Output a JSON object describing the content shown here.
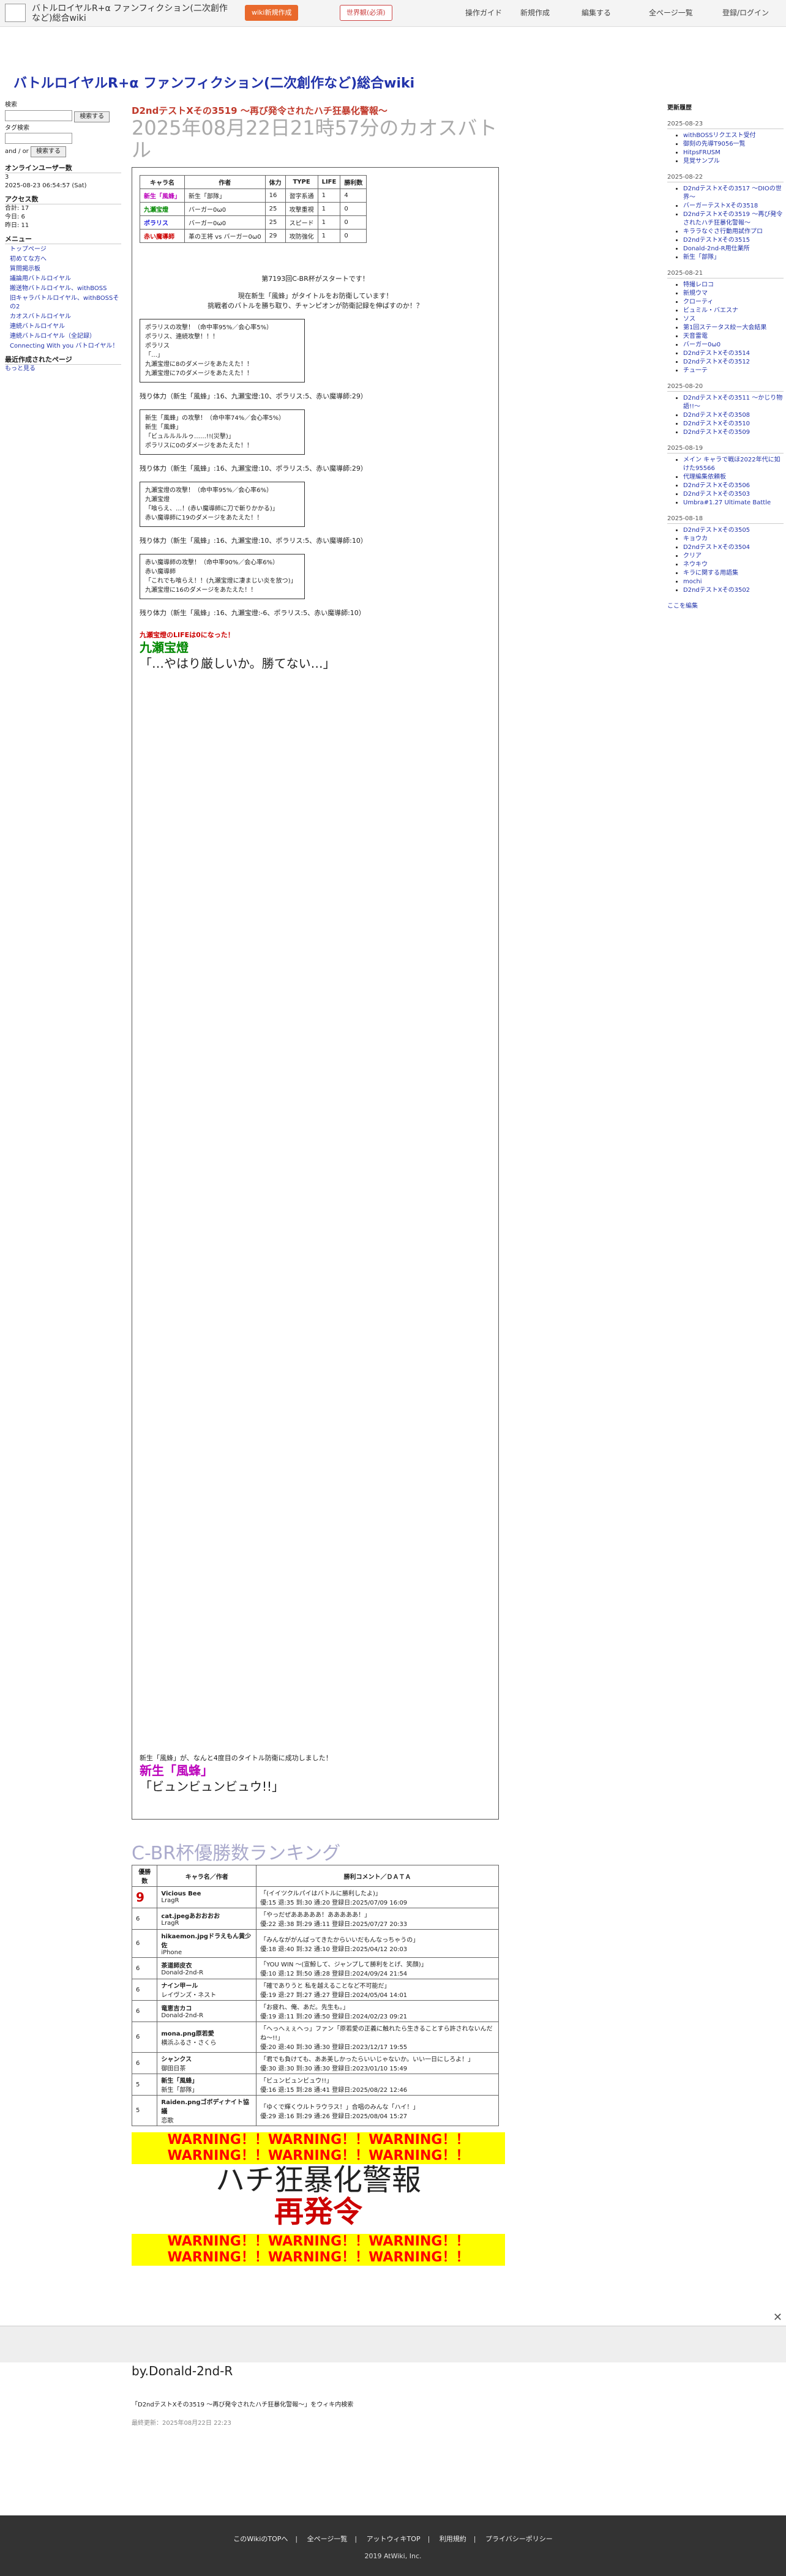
{
  "site": {
    "name": "バトルロイヤルR+α ファンフィクション(二次創作など)総合wiki",
    "title": "バトルロイヤルR+α ファンフィクション(二次創作など)総合wiki",
    "buttons": {
      "wiki_new": "wiki新規作成",
      "blank_request": "世界観(必須)",
      "guide": "操作ガイド",
      "new_page": "新規作成",
      "edit": "編集する",
      "all_pages": "全ページ一覧",
      "login": "登録/ログイン"
    }
  },
  "sidebar": {
    "search_label": "検索",
    "search_btn": "検索する",
    "tag_label": "タグ検索",
    "and_label": "and",
    "or_label": "or",
    "tag_btn": "検索する",
    "online_heading": "オンラインユーザー数",
    "online_count": "3",
    "online_date": "2025-08-23 06:54:57 (Sat)",
    "access_heading": "アクセス数",
    "access_total": "合計: 17",
    "access_today": "今日: 6",
    "access_yesterday": "昨日: 11",
    "menu_heading": "メニュー",
    "menu_items": [
      "トップページ",
      "初めてな方へ",
      "質問掲示板",
      "議論用バトルロイヤル",
      "搬送物バトルロイヤル、withBOSS",
      "旧キャラバトルロイヤル、withBOSSその2",
      "カオスバトルロイヤル",
      "連続バトルロイヤル",
      "連続バトルロイヤル（全記録）",
      "Connecting With you バトロイヤル！"
    ],
    "recent_heading": "最近作成されたページ",
    "more": "もっと見る"
  },
  "main": {
    "page_title": "D2ndテストXその3519 〜再び発令されたハチ狂暴化警報〜",
    "subtitle": "2025年08月22日21時57分のカオスバトル",
    "roster_headers": [
      "キャラ名",
      "作者",
      "体力",
      "TYPE",
      "LIFE",
      "勝利数"
    ],
    "roster": [
      {
        "name": "新生「風蜂」",
        "author": "新生「部隊」",
        "hp": "16",
        "type": "習字系通",
        "life": "1",
        "wins": "4"
      },
      {
        "name": "九瀬宝燈",
        "author": "バーガー0ω0",
        "hp": "25",
        "type": "攻撃重視",
        "life": "1",
        "wins": "0"
      },
      {
        "name": "ポラリス",
        "author": "バーガー0ω0",
        "hp": "25",
        "type": "スピード",
        "life": "1",
        "wins": "0"
      },
      {
        "name": "赤い魔導師",
        "author": "革の王将 vs バーガー0ω0",
        "hp": "29",
        "type": "攻防強化",
        "life": "1",
        "wins": "0"
      }
    ],
    "start_line": "第7193回C-BR杯がスタートです！",
    "intro_line1": "現在新生「風蜂」がタイトルをお防衛しています！",
    "intro_line2": "挑戦者のバトルを勝ち取り、チャンピオンが防衛記録を伸ばすのか！？",
    "turns": [
      {
        "text": "ポラリスの攻撃！（命中率95%／会心率5%）\nポラリス、連続攻撃！！！\nポラリス\n「…」\n九瀬宝燈に8のダメージをあたえた！！\n九瀬宝燈に7のダメージをあたえた！！",
        "remain": "残り体力（新生「風蜂」:16、九瀬宝燈:10、ポラリス:5、赤い魔導師:29）"
      },
      {
        "text": "新生「風蜂」の攻撃！（命中率74%／会心率5%）\n新生「風蜂」\n「ビュルルルルゥ……!!(災撃)」\nポラリスに0のダメージをあたえた！！",
        "remain": "残り体力（新生「風蜂」:16、九瀬宝燈:10、ポラリス:5、赤い魔導師:29）"
      },
      {
        "text": "九瀬宝燈の攻撃！（命中率95%／会心率6%）\n九瀬宝燈\n「喰らえ、…！(赤い魔導師に刀で斬りかかる)」\n赤い魔導師に19のダメージをあたえた！！",
        "remain": "残り体力（新生「風蜂」:16、九瀬宝燈:10、ポラリス:5、赤い魔導師:10）"
      },
      {
        "text": "赤い魔導師の攻撃！（命中率90%／会心率6%）\n赤い魔導師\n「これでも喰らえ！！(九瀬宝燈に凄まじい炎を放つ)」\n九瀬宝燈に16のダメージをあたえた！！",
        "remain": "残り体力（新生「風蜂」:16、九瀬宝燈:-6、ポラリス:5、赤い魔導師:10）"
      }
    ],
    "defeat1": "九瀬宝燈のLIFEは0になった！",
    "defeat1_big": "九瀬宝燈",
    "defeat1_quote": "「…やはり厳しいか。勝てない…」",
    "end_line": "新生「風蜂」が、なんと4度目のタイトル防衛に成功しました！",
    "winner_big": "新生「風蜂」",
    "winner_quote": "「ビュンビュンビュウ!!」"
  },
  "ranking": {
    "title": "C-BR杯優勝数ランキング",
    "headers": [
      "優勝数",
      "キャラ名／作者",
      "勝利コメント／ＤＡＴＡ"
    ],
    "rows": [
      {
        "wins": "9",
        "name": "Vicious Bee",
        "author": "LragR",
        "comment": "「(イイツクルパイはバトルに勝利したよ)」",
        "data": "優:15 退:35 到:30 通:20 登録日:2025/07/09 16:09"
      },
      {
        "wins": "6",
        "name": "cat.jpegあおおおお",
        "author": "LragR",
        "comment": "「やっだぜあああああ！あああああ！」",
        "data": "優:22 退:38 到:29 通:11 登録日:2025/07/27 20:33"
      },
      {
        "wins": "6",
        "name": "hikaemon.jpgドラえもん黄少佐",
        "author": "iPhone",
        "comment": "「みんなががんばってきたからいいだもんなっちゃうの」",
        "data": "優:18 退:40 到:32 通:10 登録日:2025/04/12 20:03"
      },
      {
        "wins": "6",
        "name": "茶道師皮衣",
        "author": "Donald-2nd-R",
        "comment": "「YOU WIN 〜(宣鯨して、ジャンプして勝利をとげ、笑顔)」",
        "data": "優:10 退:12 到:50 通:28 登録日:2024/09/24 21:54"
      },
      {
        "wins": "6",
        "name": "ナイン甲ール",
        "author": "レイヴンズ・ネスト",
        "comment": "「確でありうと 私を越えることなど不可能だ」",
        "data": "優:19 退:27 到:27 通:27 登録日:2024/05/04 14:01"
      },
      {
        "wins": "6",
        "name": "竜恵吉カコ",
        "author": "Donald-2nd-R",
        "comment": "「お疲れ、俺、あだ。先生も。」",
        "data": "優:19 退:11 到:20 通:50 登録日:2024/02/23 09:21"
      },
      {
        "wins": "6",
        "name": "mona.png原若愛",
        "author": "横浜ふるさ・さくら",
        "comment": "「へっへぇぇへっ」ファン「原若愛の正義に触れたら生きることすら許されないんだね〜!!」",
        "data": "優:20 退:40 到:30 通:30 登録日:2023/12/17 19:55"
      },
      {
        "wins": "6",
        "name": "シャンクス",
        "author": "御田日茶",
        "comment": "「君でも負けても、ああ美しかったらいいじゃないか。いい一日にしろよ！」",
        "data": "優:30 退:30 到:30 通:30 登録日:2023/01/10 15:49"
      },
      {
        "wins": "5",
        "name": "新生「風蜂」",
        "author": "新生「部隊」",
        "comment": "「ビュンビュンビュウ!!」",
        "data": "優:16 退:15 到:28 通:41 登録日:2025/08/22 12:46"
      },
      {
        "wins": "5",
        "name": "Raiden.pngゴボディナイト協議",
        "author": "恋歌",
        "comment": "「ゆくで輝くウルトラウラス！」合唱のみんな「ハイ！」",
        "data": "優:29 退:16 到:29 通:26 登録日:2025/08/04 15:27"
      }
    ]
  },
  "warning": {
    "banner": "WARNING！！WARNING！！WARNING！！WARNING！！WARNING！！WARNING！！",
    "line1": "ハチ狂暴化警報",
    "line2": "再発令"
  },
  "byline": "by.Donald-2nd-R",
  "tagline": "「D2ndテストXその3519 〜再び発令されたハチ狂暴化警報〜」をウィキ内検索",
  "updated": "最終更新：2025年08月22日 22:23",
  "right": {
    "heading": "更新履歴",
    "groups": [
      {
        "date": "2025-08-23",
        "items": [
          "withBOSSリクエスト受付",
          "御刻の先導T9056一覧",
          "HitpsFRUSM",
          "見覚サンプル"
        ]
      },
      {
        "date": "2025-08-22",
        "items": [
          "D2ndテストXその3517 〜DIOの世界〜",
          "バーガーテストXその3518",
          "D2ndテストXその3519 〜再び発令されたハチ狂暴化警報〜",
          "キララなぐさ行動用試作プロ",
          "D2ndテストXその3515",
          "Donald-2nd-R用仕業所",
          "新生「部隊」"
        ]
      },
      {
        "date": "2025-08-21",
        "items": [
          "特撮レロコ",
          "新規ウマ",
          "クローティ",
          "ビュミル・バエスナ",
          "ソス",
          "第1回ステータス絞ー大会結果",
          "天音雷電",
          "バーガー0ω0",
          "D2ndテストXその3514",
          "D2ndテストXその3512",
          "チュ一テ"
        ]
      },
      {
        "date": "2025-08-20",
        "items": [
          "D2ndテストXその3511 〜かじり物語!!〜",
          "D2ndテストXその3508",
          "D2ndテストXその3510",
          "D2ndテストXその3509"
        ]
      },
      {
        "date": "2025-08-19",
        "items": [
          "メイン キャラで戦ほ2022年代に如けた95566",
          "代理編集依頼板",
          "D2ndテストXその3506",
          "D2ndテストXその3503",
          "Umbra#1.27 Ultimate Battle"
        ]
      },
      {
        "date": "2025-08-18",
        "items": [
          "D2ndテストXその3505",
          "キョウカ",
          "D2ndテストXその3504",
          "クリア",
          "ネウキウ",
          "キラに関する用語集",
          "mochi",
          "D2ndテストXその3502"
        ]
      }
    ],
    "edit_link": "ここを編集"
  },
  "footer": {
    "links": [
      "このWikiのTOPへ",
      "全ページ一覧",
      "アットウィキTOP",
      "利用規約",
      "プライバシーポリシー"
    ],
    "copyright": "2019 AtWiki, Inc."
  }
}
